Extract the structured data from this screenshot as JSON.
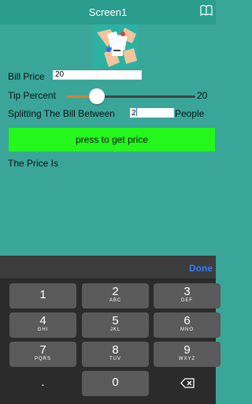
{
  "title_bar": {
    "title": "Screen1",
    "book_icon": "book-icon"
  },
  "form": {
    "bill_label": "Bill Price",
    "bill_value": "20",
    "tip_label": "Tip Percent",
    "tip_value": "20",
    "tip_percent_level": 0.24,
    "split_label": "Splitting The Bill Between",
    "split_value": "2",
    "people_label": "People",
    "button_label": "press to get price",
    "price_label": "The Price Is"
  },
  "keyboard": {
    "done_label": "Done",
    "keys": [
      {
        "digit": "1",
        "letters": ""
      },
      {
        "digit": "2",
        "letters": "ABC"
      },
      {
        "digit": "3",
        "letters": "DEF"
      },
      {
        "digit": "4",
        "letters": "GHI"
      },
      {
        "digit": "5",
        "letters": "JKL"
      },
      {
        "digit": "6",
        "letters": "MNO"
      },
      {
        "digit": "7",
        "letters": "PQRS"
      },
      {
        "digit": "8",
        "letters": "TUV"
      },
      {
        "digit": "9",
        "letters": "WXYZ"
      },
      {
        "digit": ".",
        "letters": ""
      },
      {
        "digit": "0",
        "letters": ""
      },
      {
        "digit": "",
        "letters": ""
      }
    ],
    "backspace_icon": "backspace-icon"
  },
  "colors": {
    "background": "#3aa69a",
    "title_bar": "#2a9d8f",
    "button": "#23f71b",
    "slider_fill": "#d9822b",
    "done": "#2f7cf6"
  }
}
